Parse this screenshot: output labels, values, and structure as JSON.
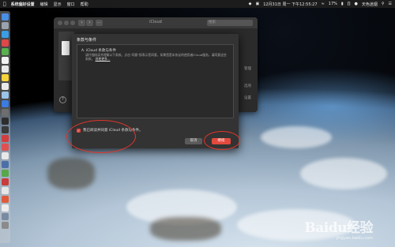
{
  "menubar": {
    "app_name": "系统偏好设置",
    "menus": [
      "编辑",
      "显示",
      "窗口",
      "帮助"
    ],
    "clock": "12月31日 周一 下午12:55:27",
    "battery": "17%",
    "user": "天色迷烟"
  },
  "prefs_window": {
    "title": "iCloud",
    "search_placeholder": "搜索",
    "help": "?",
    "right_labels": [
      "管理",
      "选项",
      "设置"
    ]
  },
  "terms_dialog": {
    "title": "条款与条件",
    "heading": "A. iCloud 条款与条件",
    "body": "请仔细阅读并理解以下条款。点击\"同意\"即表示您同意，如果您是本协议的使用者iCloud服务，请同意这些条款。",
    "link_label": "其他更多...",
    "agree_checkbox_label": "我已阅读并同意 iCloud 条款与条件。",
    "cancel_label": "取消",
    "agree_label": "继续"
  },
  "watermark": {
    "logo": "Baidu经验",
    "sub": "jingyan.baidu.com"
  },
  "colors": {
    "accent_red": "#e34a3d",
    "annotation_red": "#e0352b"
  },
  "icons": [
    "apple-icon",
    "wifi-icon",
    "battery-icon",
    "bluetooth-icon",
    "search-icon",
    "menu-icon",
    "checkmark-icon"
  ]
}
